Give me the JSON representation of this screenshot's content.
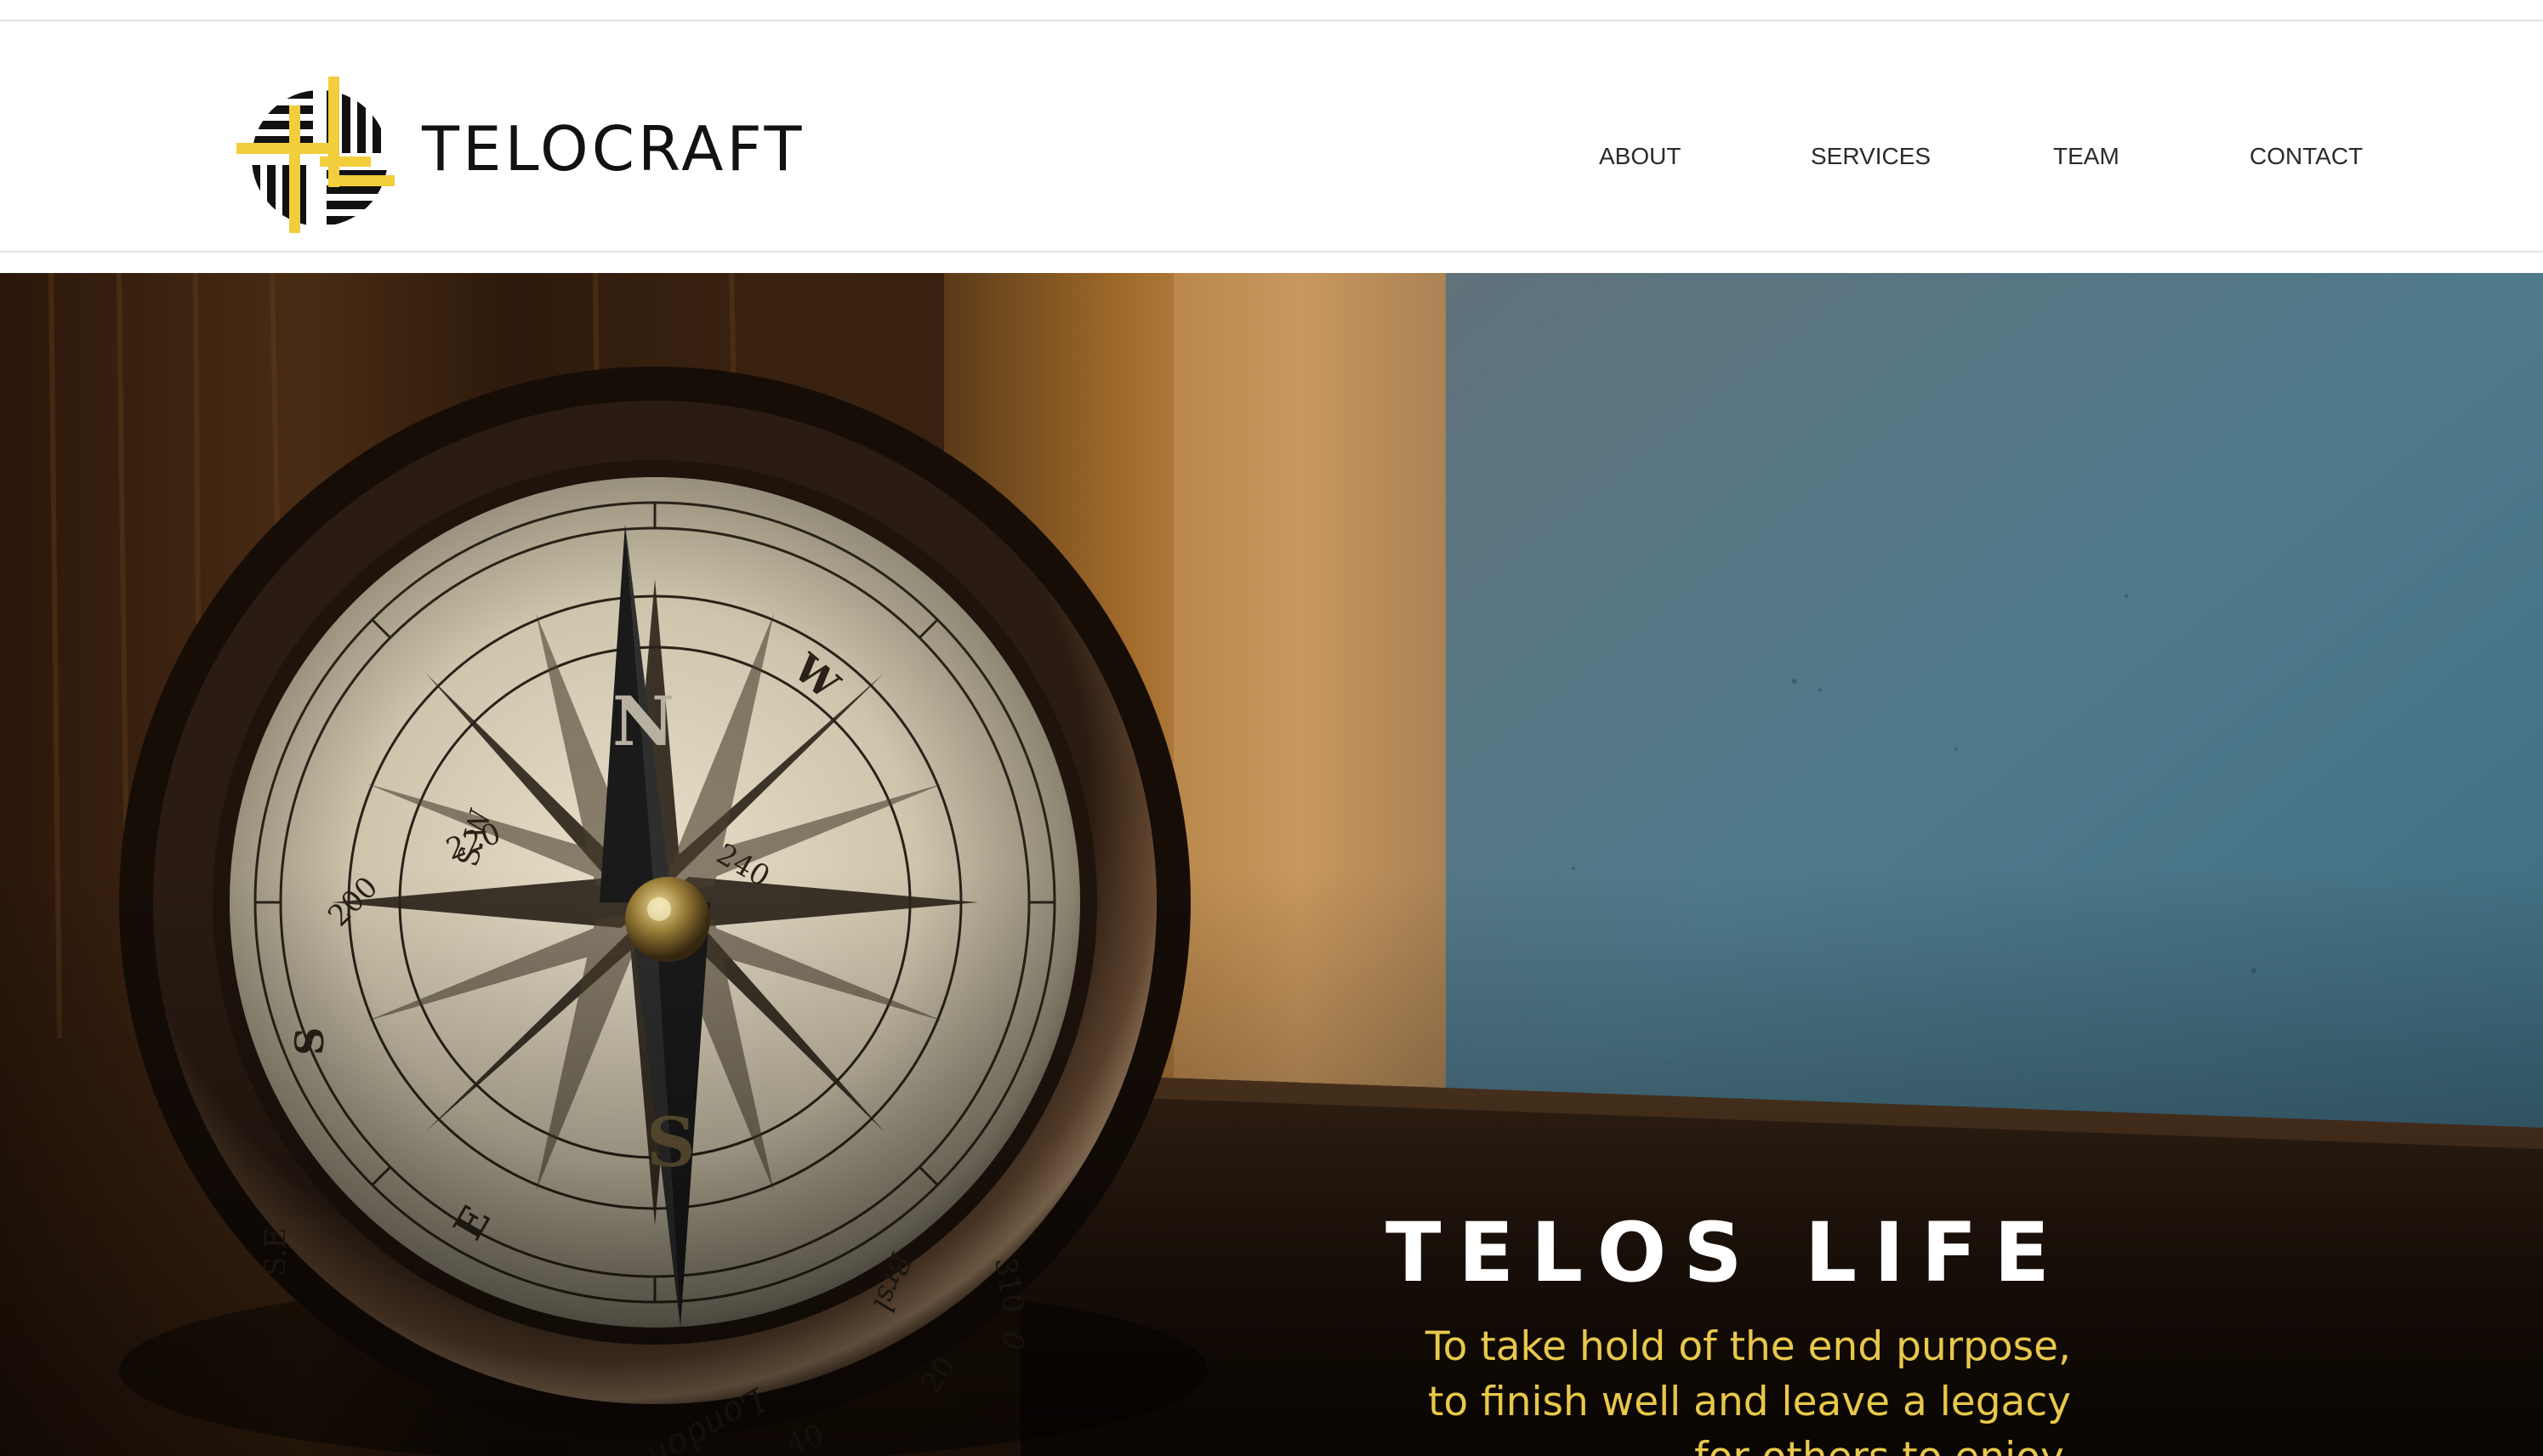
{
  "header": {
    "brand_name": "TELOCRAFT",
    "logo_icon": "telocraft-logo-icon"
  },
  "nav": {
    "items": [
      {
        "label": "ABOUT"
      },
      {
        "label": "SERVICES"
      },
      {
        "label": "TEAM"
      },
      {
        "label": "CONTACT"
      }
    ]
  },
  "hero": {
    "title": "TELOS LIFE",
    "tagline": {
      "line1": "To take hold of the end purpose,",
      "line2": "to finish well and leave a legacy",
      "line3": "for others to enjoy."
    },
    "background_image": "compass-on-windowsill-photo",
    "compass_text": {
      "n": "N",
      "s": "S",
      "w": "W",
      "e": "E",
      "sw": "S.W",
      "ss": "S",
      "se": "S.E",
      "n220": "220",
      "n200": "200",
      "n240": "240",
      "n310": "310",
      "n20": "20",
      "n40": "40",
      "n0": "0",
      "brand": "London",
      "brand2": "Brsl"
    }
  },
  "colors": {
    "accent_yellow": "#f2cd3c",
    "tagline_yellow": "#e8c84a",
    "brand_black": "#121212",
    "nav_text": "#2b2b2b"
  }
}
